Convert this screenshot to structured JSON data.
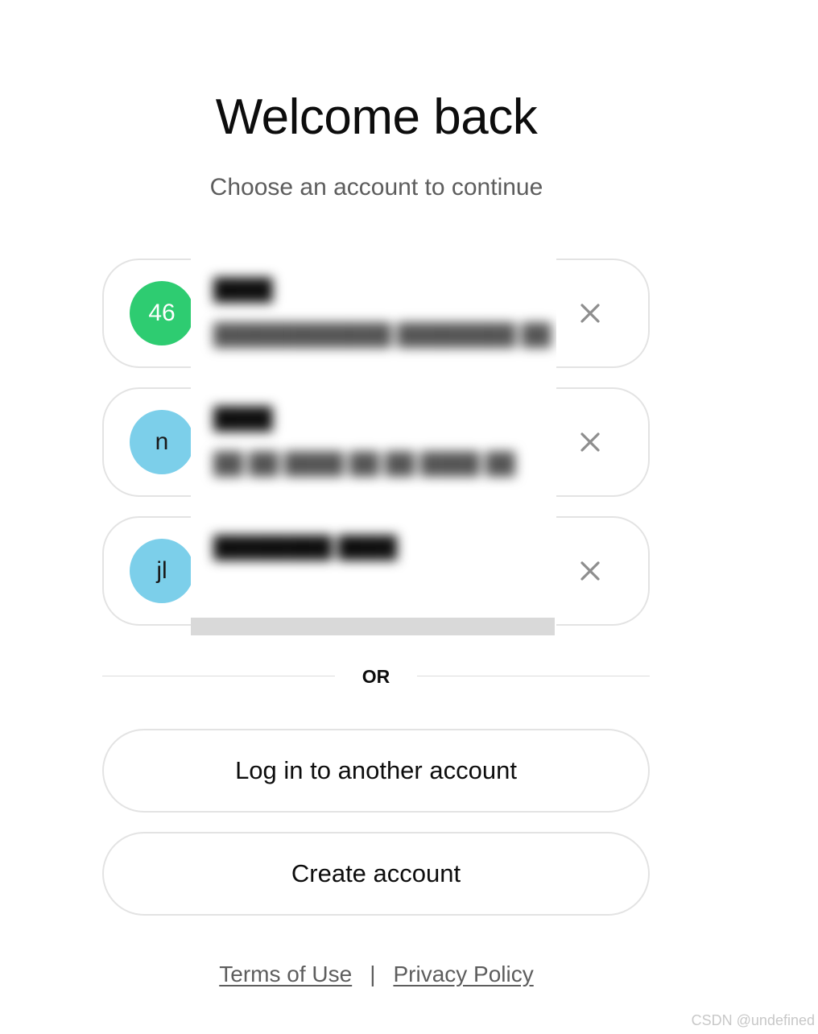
{
  "header": {
    "title": "Welcome back",
    "subtitle": "Choose an account to continue"
  },
  "accounts": [
    {
      "avatar_text": "46",
      "avatar_color": "#2ecc71",
      "name": "████",
      "email": "████████████ ████████ ██",
      "remove_icon": "close-icon"
    },
    {
      "avatar_text": "n",
      "avatar_color": "#7ccfea",
      "name": "████",
      "email": "██ ██ ████ ██ ██ ████ ██",
      "remove_icon": "close-icon"
    },
    {
      "avatar_text": "jl",
      "avatar_color": "#7ccfea",
      "name": "████████ ████",
      "email": "",
      "remove_icon": "close-icon"
    }
  ],
  "divider": {
    "label": "OR"
  },
  "actions": {
    "login_other": "Log in to another account",
    "create_account": "Create account"
  },
  "footer": {
    "terms": "Terms of Use",
    "separator": "|",
    "privacy": "Privacy Policy"
  },
  "watermark": "CSDN @undefined",
  "colors": {
    "border": "#e3e3e3",
    "text_primary": "#0d0d0d",
    "text_secondary": "#5d5d5d",
    "close_icon": "#8e8e8e"
  }
}
